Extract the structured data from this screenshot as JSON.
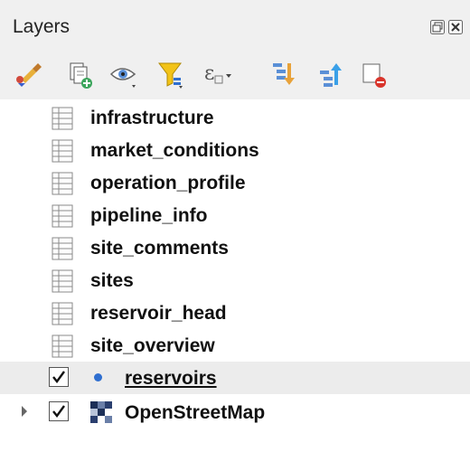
{
  "panel": {
    "title": "Layers"
  },
  "toolbar": {
    "buttons": [
      {
        "icon": "style-brush-icon"
      },
      {
        "icon": "add-group-icon"
      },
      {
        "icon": "visibility-eye-icon"
      },
      {
        "icon": "filter-legend-icon"
      },
      {
        "icon": "expression-filter-icon"
      },
      {
        "icon": "expand-all-icon"
      },
      {
        "icon": "collapse-all-icon"
      },
      {
        "icon": "remove-layer-icon"
      }
    ]
  },
  "layers": [
    {
      "name": "infrastructure",
      "kind": "table"
    },
    {
      "name": "market_conditions",
      "kind": "table"
    },
    {
      "name": "operation_profile",
      "kind": "table"
    },
    {
      "name": "pipeline_info",
      "kind": "table"
    },
    {
      "name": "site_comments",
      "kind": "table"
    },
    {
      "name": "sites",
      "kind": "table"
    },
    {
      "name": "reservoir_head",
      "kind": "table"
    },
    {
      "name": "site_overview",
      "kind": "table"
    },
    {
      "name": "reservoirs",
      "kind": "point",
      "checked": true,
      "selected": true
    },
    {
      "name": "OpenStreetMap",
      "kind": "raster",
      "checked": true,
      "expandable": true
    }
  ],
  "colors": {
    "point_symbol": "#2f6fd0",
    "selection": "#ececec"
  }
}
